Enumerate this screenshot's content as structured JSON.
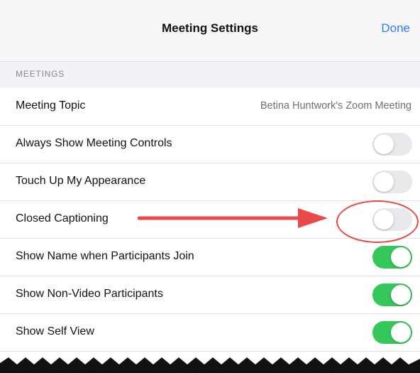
{
  "header": {
    "title": "Meeting Settings",
    "done_label": "Done"
  },
  "section": {
    "title": "MEETINGS"
  },
  "rows": [
    {
      "label": "Meeting Topic",
      "value": "Betina Huntwork's Zoom Meeting"
    },
    {
      "label": "Always Show Meeting Controls",
      "toggle_on": false
    },
    {
      "label": "Touch Up My Appearance",
      "toggle_on": false
    },
    {
      "label": "Closed Captioning",
      "toggle_on": false
    },
    {
      "label": "Show Name when Participants Join",
      "toggle_on": true
    },
    {
      "label": "Show Non-Video Participants",
      "toggle_on": true
    },
    {
      "label": "Show Self View",
      "toggle_on": true
    }
  ],
  "colors": {
    "accent": "#2d7ff9",
    "toggle_on": "#34c759",
    "toggle_off": "#e9e9eb",
    "annotation": "#e84a4a"
  },
  "annotation": {
    "arrow": "arrow-right-icon",
    "highlight": "ellipse-highlight"
  }
}
